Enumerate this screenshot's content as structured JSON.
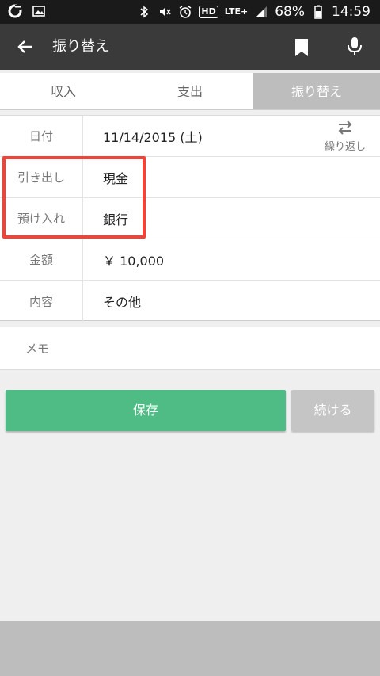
{
  "status_bar": {
    "battery": "68%",
    "time": "14:59",
    "hd": "HD",
    "lte": "LTE+"
  },
  "app_bar": {
    "title": "振り替え"
  },
  "tabs": [
    {
      "label": "収入"
    },
    {
      "label": "支出"
    },
    {
      "label": "振り替え"
    }
  ],
  "form": {
    "date": {
      "label": "日付",
      "value": "11/14/2015 (土)"
    },
    "repeat_label": "繰り返し",
    "withdraw": {
      "label": "引き出し",
      "value": "現金"
    },
    "deposit": {
      "label": "預け入れ",
      "value": "銀行"
    },
    "amount": {
      "label": "金額",
      "value": "￥ 10,000"
    },
    "content": {
      "label": "内容",
      "value": "その他"
    }
  },
  "memo": {
    "label": "メモ"
  },
  "buttons": {
    "save": "保存",
    "continue": "続ける"
  },
  "colors": {
    "save": "#50bc85",
    "highlight": "#f44336",
    "app_bar": "#3a3a3a"
  }
}
